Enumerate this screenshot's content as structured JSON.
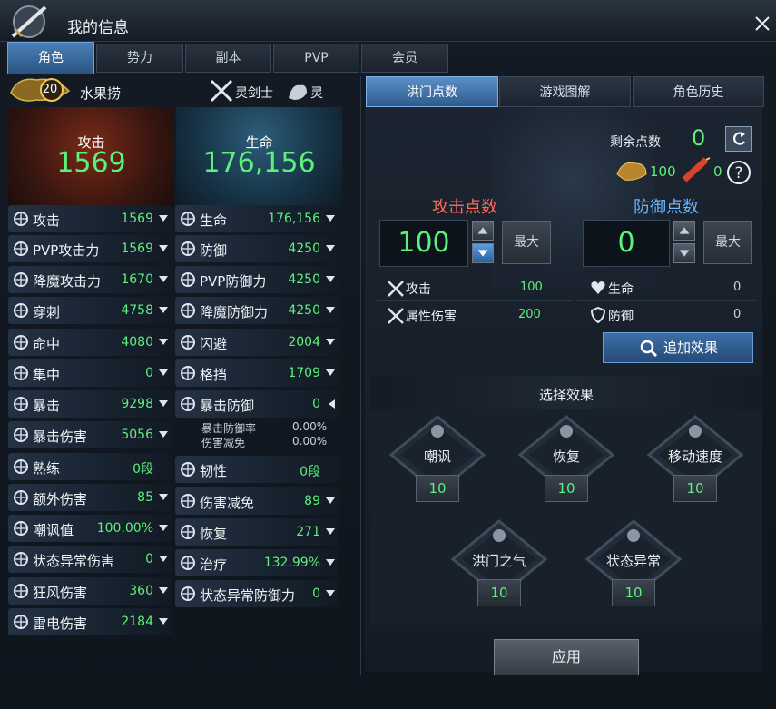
{
  "window": {
    "title": "我的信息"
  },
  "main_tabs": [
    {
      "label": "角色",
      "active": true
    },
    {
      "label": "势力",
      "active": false
    },
    {
      "label": "副本",
      "active": false
    },
    {
      "label": "PVP",
      "active": false
    },
    {
      "label": "会员",
      "active": false
    }
  ],
  "character": {
    "level": "20",
    "name": "水果捞",
    "class": "灵剑士",
    "race": "灵"
  },
  "summary": {
    "attack_label": "攻击",
    "attack_value": "1569",
    "hp_label": "生命",
    "hp_value": "176,156"
  },
  "left_stats": [
    {
      "name": "攻击",
      "value": "1569",
      "icon": "sword-icon"
    },
    {
      "name": "PVP攻击力",
      "value": "1569",
      "icon": "pvp-attack-icon"
    },
    {
      "name": "降魔攻击力",
      "value": "1670",
      "icon": "demon-attack-icon"
    },
    {
      "name": "穿刺",
      "value": "4758",
      "icon": "pierce-icon"
    },
    {
      "name": "命中",
      "value": "4080",
      "icon": "target-icon"
    },
    {
      "name": "集中",
      "value": "0",
      "icon": "focus-icon"
    },
    {
      "name": "暴击",
      "value": "9298",
      "icon": "critical-icon"
    },
    {
      "name": "暴击伤害",
      "value": "5056",
      "icon": "critical-damage-icon"
    },
    {
      "name": "熟练",
      "value": "0段",
      "icon": "mastery-icon"
    },
    {
      "name": "额外伤害",
      "value": "85",
      "icon": "extra-damage-icon"
    },
    {
      "name": "嘲讽值",
      "value": "100.00%",
      "icon": "skull-icon"
    },
    {
      "name": "状态异常伤害",
      "value": "0",
      "icon": "debuff-damage-icon"
    },
    {
      "name": "狂风伤害",
      "value": "360",
      "icon": "wind-icon"
    },
    {
      "name": "雷电伤害",
      "value": "2184",
      "icon": "lightning-icon"
    }
  ],
  "right_stats": [
    {
      "name": "生命",
      "value": "176,156",
      "icon": "heart-icon"
    },
    {
      "name": "防御",
      "value": "4250",
      "icon": "shield-icon"
    },
    {
      "name": "PVP防御力",
      "value": "4250",
      "icon": "pvp-defense-icon"
    },
    {
      "name": "降魔防御力",
      "value": "4250",
      "icon": "demon-defense-icon"
    },
    {
      "name": "闪避",
      "value": "2004",
      "icon": "evade-icon"
    },
    {
      "name": "格挡",
      "value": "1709",
      "icon": "block-icon"
    },
    {
      "name": "暴击防御",
      "value": "0",
      "icon": "critical-defense-icon"
    },
    {
      "name": "韧性",
      "value": "0段",
      "icon": "toughness-icon"
    },
    {
      "name": "伤害减免",
      "value": "89",
      "icon": "damage-reduction-icon"
    },
    {
      "name": "恢复",
      "value": "271",
      "icon": "recovery-icon"
    },
    {
      "name": "治疗",
      "value": "132.99%",
      "icon": "heal-icon"
    },
    {
      "name": "状态异常防御力",
      "value": "0",
      "icon": "debuff-defense-icon"
    }
  ],
  "crit_defense_sub": [
    {
      "name": "暴击防御率",
      "value": "0.00%"
    },
    {
      "name": "伤害减免",
      "value": "0.00%"
    }
  ],
  "right_tabs": [
    {
      "label": "洪门点数",
      "active": true
    },
    {
      "label": "游戏图解",
      "active": false
    },
    {
      "label": "角色历史",
      "active": false
    }
  ],
  "points": {
    "remaining_label": "剩余点数",
    "remaining_value": "0",
    "currency_a": "100",
    "currency_b": "0",
    "attack_label": "攻击点数",
    "attack_value": "100",
    "defense_label": "防御点数",
    "defense_value": "0",
    "max_label": "最大"
  },
  "attack_effects": [
    {
      "name": "攻击",
      "value": "100"
    },
    {
      "name": "属性伤害",
      "value": "200"
    }
  ],
  "defense_effects": [
    {
      "name": "生命",
      "value": "0"
    },
    {
      "name": "防御",
      "value": "0"
    }
  ],
  "add_effect_label": "追加效果",
  "select_title": "选择效果",
  "effects": [
    {
      "name": "嘲讽",
      "value": "10",
      "icon": "skull-icon"
    },
    {
      "name": "恢复",
      "value": "10",
      "icon": "sprout-icon"
    },
    {
      "name": "移动速度",
      "value": "10",
      "icon": "runner-icon"
    },
    {
      "name": "洪门之气",
      "value": "10",
      "icon": "dragon-icon"
    },
    {
      "name": "状态异常",
      "value": "10",
      "icon": "star-icon"
    }
  ],
  "apply_label": "应用",
  "colors": {
    "accent": "#4a7fb8",
    "green": "#5df07a",
    "attack_red": "#ff6a5a",
    "defense_blue": "#6ab6ff"
  }
}
